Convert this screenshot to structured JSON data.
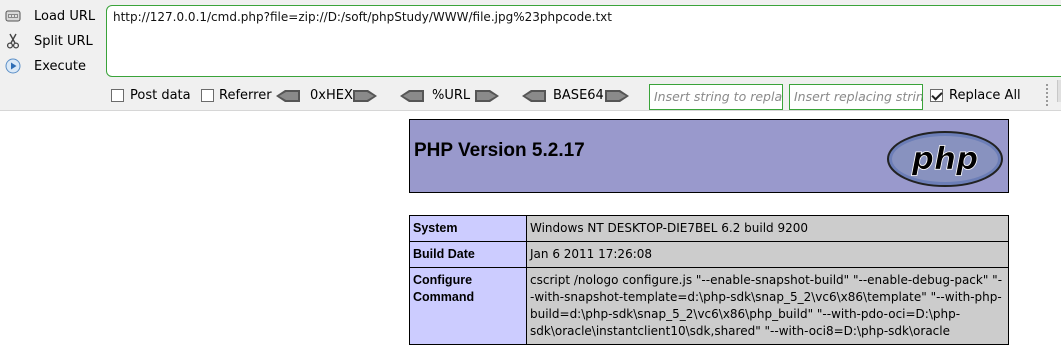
{
  "hackbar": {
    "load_url_label": "Load URL",
    "split_url_label": "Split URL",
    "execute_label": "Execute",
    "url_value": "http://127.0.0.1/cmd.php?file=zip://D:/soft/phpStudy/WWW/file.jpg%23phpcode.txt",
    "post_data_label": "Post data",
    "referrer_label": "Referrer",
    "hex_label": "0xHEX",
    "url_enc_label": "%URL",
    "base64_label": "BASE64",
    "search_placeholder": "Insert string to replace",
    "replace_placeholder": "Insert replacing string",
    "replace_all_label": "Replace All",
    "post_data_checked": false,
    "referrer_checked": false,
    "replace_all_checked": true,
    "accent_color": "#3aa33a"
  },
  "phpinfo": {
    "title": "PHP Version 5.2.17",
    "logo_text": "php",
    "header_color": "#9999cc",
    "rows": [
      {
        "key": "System",
        "value": "Windows NT DESKTOP-DIE7BEL 6.2 build 9200"
      },
      {
        "key": "Build Date",
        "value": "Jan 6 2011 17:26:08"
      },
      {
        "key": "Configure Command",
        "value": "cscript /nologo configure.js \"--enable-snapshot-build\" \"--enable-debug-pack\" \"--with-snapshot-template=d:\\php-sdk\\snap_5_2\\vc6\\x86\\template\" \"--with-php-build=d:\\php-sdk\\snap_5_2\\vc6\\x86\\php_build\" \"--with-pdo-oci=D:\\php-sdk\\oracle\\instantclient10\\sdk,shared\" \"--with-oci8=D:\\php-sdk\\oracle"
      }
    ]
  }
}
